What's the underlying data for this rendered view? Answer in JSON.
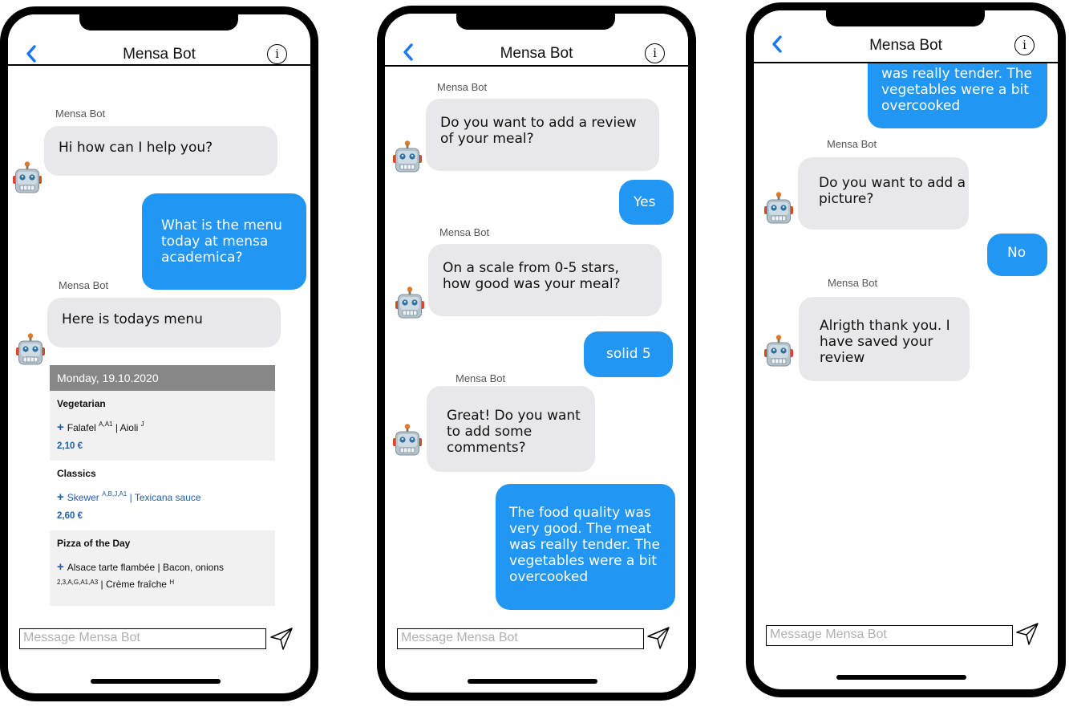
{
  "app": {
    "title": "Mensa Bot",
    "info_label": "i",
    "input_placeholder": "Message Mensa Bot",
    "sender_name": "Mensa Bot"
  },
  "colors": {
    "accent": "#2196f3",
    "bot_bubble": "#e8e8ea",
    "menu_header": "#878787",
    "link_blue": "#1f5fa8"
  },
  "phone1": {
    "messages": [
      {
        "from": "bot",
        "sender": "Mensa Bot",
        "text": "Hi how can I help you?"
      },
      {
        "from": "user",
        "text": "What is the menu today at mensa academica?"
      },
      {
        "from": "bot",
        "sender": "Mensa Bot",
        "text": "Here is todays menu"
      }
    ],
    "menu": {
      "date": "Monday, 19.10.2020",
      "sections": [
        {
          "name": "Vegetarian",
          "dish": "Falafel",
          "dish_sup": "A,A1",
          "side": "Aioli",
          "side_sup": "J",
          "price": "2,10 €"
        },
        {
          "name": "Classics",
          "dish": "Skewer",
          "dish_sup": "A,B,J,A1",
          "side": "Texicana sauce",
          "price": "2,60 €"
        },
        {
          "name": "Pizza of the Day",
          "dish": "Alsace tarte flambée | Bacon, onions",
          "line2_sup": "2,3,A,G,A1,A3",
          "line2": "Crème fraîche",
          "line2_sup2": "H"
        }
      ]
    }
  },
  "phone2": {
    "messages": [
      {
        "from": "bot",
        "sender": "Mensa Bot",
        "text": "Do you want to add a review of your meal?"
      },
      {
        "from": "user",
        "text": "Yes"
      },
      {
        "from": "bot",
        "sender": "Mensa Bot",
        "text": "On a scale from 0-5 stars, how good was your meal?"
      },
      {
        "from": "user",
        "text": "solid 5"
      },
      {
        "from": "bot",
        "sender": "Mensa Bot",
        "text": "Great! Do you want to add some comments?"
      },
      {
        "from": "user",
        "text": "The food quality was very good. The meat was really tender. The vegetables were a bit overcooked"
      }
    ]
  },
  "phone3": {
    "messages": [
      {
        "from": "user",
        "text": "was really tender. The vegetables were a bit overcooked"
      },
      {
        "from": "bot",
        "sender": "Mensa Bot",
        "text": "Do you want to add a picture?"
      },
      {
        "from": "user",
        "text": "No"
      },
      {
        "from": "bot",
        "sender": "Mensa Bot",
        "text": "Alrigth thank you. I have saved your review"
      }
    ]
  }
}
